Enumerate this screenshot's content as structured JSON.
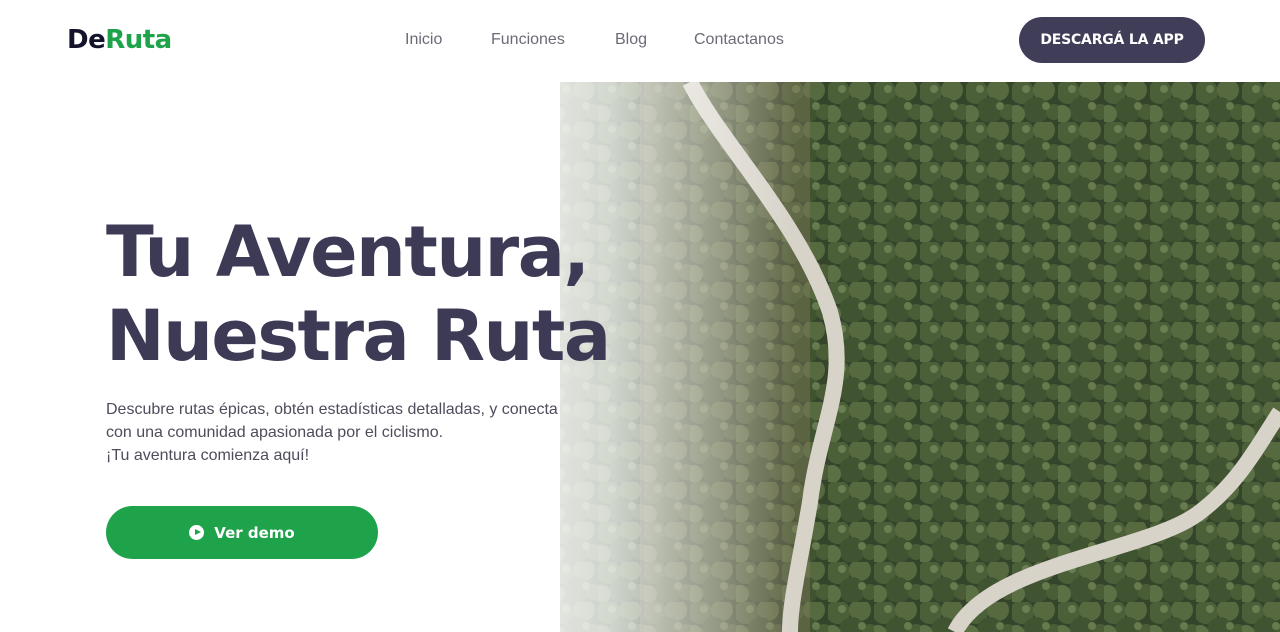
{
  "brand": {
    "logo_part1": "De",
    "logo_part2": "Ruta",
    "color_dark": "#13132b",
    "color_green": "#1ea34a"
  },
  "nav": {
    "items": [
      {
        "label": "Inicio"
      },
      {
        "label": "Funciones"
      },
      {
        "label": "Blog"
      },
      {
        "label": "Contactanos"
      }
    ]
  },
  "header": {
    "cta_label": "DESCARGÁ LA APP",
    "cta_color": "#403d58"
  },
  "hero": {
    "headline_line1": "Tu Aventura,",
    "headline_line2": "Nuestra Ruta",
    "subtext_line1": "Descubre rutas épicas, obtén estadísticas detalladas, y conecta",
    "subtext_line2": "con una comunidad apasionada por el ciclismo.",
    "subtext_line3": "¡Tu aventura comienza aquí!",
    "demo_label": "Ver demo",
    "demo_icon": "play-circle-icon",
    "headline_color": "#3d3a56"
  }
}
